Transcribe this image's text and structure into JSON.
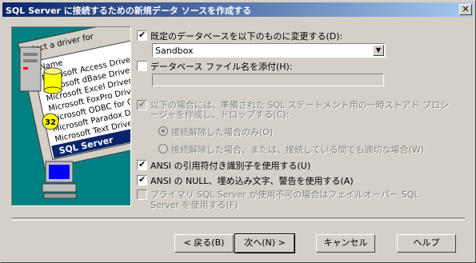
{
  "window": {
    "title": "SQL Server に接続するための新規データ ソースを作成する",
    "close_label": "✕"
  },
  "art": {
    "header": "Select a driver for",
    "items": [
      "Name",
      "Microsoft Access Driver",
      "Microsoft dBase Driver",
      "Microsoft Excel Driver",
      "Microsoft FoxPro Driver",
      "Microsoft ODBC for Oracle",
      "Microsoft Paradox Driver",
      "Microsoft Text Driver",
      "SQL Server"
    ],
    "badge": "32"
  },
  "options": {
    "change_db": {
      "label": "既定のデータベースを以下のものに変更する(D):",
      "checked": true
    },
    "database": {
      "value": "Sandbox"
    },
    "attach_file": {
      "label": "データベース ファイル名を添付(H):",
      "checked": false
    },
    "stored_proc": {
      "label_line1": "以下の場合には、準備された SQL ステートメント用の一時ストアド プロシ",
      "label_line2": "ージャを作成し、ドロップする(C):",
      "checked": true
    },
    "radio1": {
      "label": "接続解除した場合のみ(O)",
      "selected": true
    },
    "radio2": {
      "label": "接続解除した場合、または、接続している間でも適切な場合(W)",
      "selected": false
    },
    "quoted_ids": {
      "label": "ANSI の引用符付き識別子を使用する(U)",
      "checked": true
    },
    "ansi_nulls": {
      "label": "ANSI の NULL、埋め込み文字、警告を使用する(A)",
      "checked": true
    },
    "failover": {
      "label_line1": "プライマリ SQL Server が使用不可の場合はフェイルオーバー SQL",
      "label_line2": "Server を使用する(F)",
      "checked": false
    }
  },
  "buttons": {
    "back": "< 戻る(B)",
    "next": "次へ(N) >",
    "cancel": "キャンセル",
    "help": "ヘルプ"
  }
}
